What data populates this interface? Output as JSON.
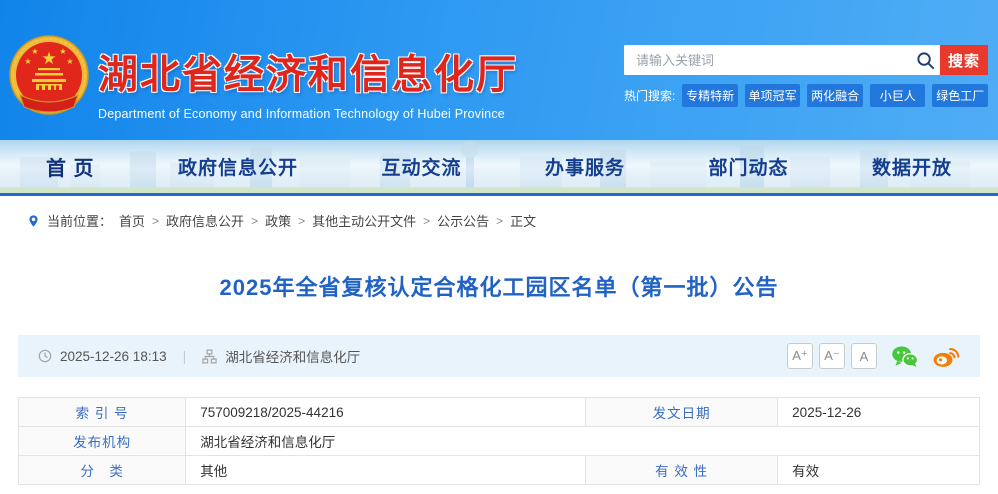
{
  "header": {
    "site_title": "湖北省经济和信息化厅",
    "site_subtitle": "Department of Economy and Information Technology of Hubei Province",
    "search": {
      "placeholder": "请输入关键词",
      "button_label": "搜索",
      "hot_label": "热门搜索:",
      "hot_tags": [
        "专精特新",
        "单项冠军",
        "两化融合",
        "小巨人",
        "绿色工厂"
      ]
    }
  },
  "nav": {
    "items": [
      {
        "label": "首 页"
      },
      {
        "label": "政府信息公开"
      },
      {
        "label": "互动交流"
      },
      {
        "label": "办事服务"
      },
      {
        "label": "部门动态"
      },
      {
        "label": "数据开放"
      }
    ]
  },
  "breadcrumb": {
    "label": "当前位置：",
    "separator": ">",
    "items": [
      "首页",
      "政府信息公开",
      "政策",
      "其他主动公开文件",
      "公示公告",
      "正文"
    ]
  },
  "article": {
    "title": "2025年全省复核认定合格化工园区名单（第一批）公告",
    "publish_time": "2025-12-26 18:13",
    "divider": "|",
    "source": "湖北省经济和信息化厅",
    "font_tools": [
      "A⁺",
      "A⁻",
      "A"
    ]
  },
  "info_table": {
    "rows": [
      {
        "label1": "索 引 号",
        "value1": "757009218/2025-44216",
        "label2": "发文日期",
        "value2": "2025-12-26"
      },
      {
        "label1": "发布机构",
        "value1": "湖北省经济和信息化厅"
      },
      {
        "label1": "分　类",
        "value1": "其他",
        "label2": "有 效 性",
        "value2": "有效"
      }
    ]
  },
  "icons": {
    "emblem": "china-national-emblem",
    "search": "magnifier",
    "breadcrumb": "location-pin",
    "time": "clock",
    "source": "org-chart",
    "wechat": "wechat-share",
    "weibo": "weibo-share"
  },
  "colors": {
    "header_blue": "#2f9af2",
    "brand_red": "#e0261c",
    "nav_text_blue": "#153f8e",
    "nav_line_blue": "#1e6bd8",
    "title_blue": "#2163c5",
    "tag_blue": "#2277dc",
    "search_red": "#e8392c",
    "meta_band_bg": "#e9f3fb",
    "table_label_blue": "#3a6cc4",
    "wechat_green": "#47c83c",
    "weibo_orange": "#f0800a"
  }
}
